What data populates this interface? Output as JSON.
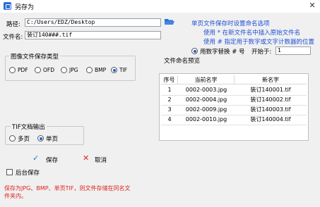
{
  "window": {
    "title": "另存为",
    "close_glyph": "✕"
  },
  "path": {
    "label": "路径:",
    "value": "C:/Users/EDZ/Desktop"
  },
  "filename": {
    "label": "文件名:",
    "value": "装订140###.tif"
  },
  "format_group": {
    "title": "图像文件保存类型",
    "options": [
      "PDF",
      "OFD",
      "JPG",
      "BMP",
      "TIF"
    ],
    "selected": "TIF"
  },
  "tif_group": {
    "title": "TIF文档输出",
    "options": [
      "多页",
      "单页"
    ],
    "selected": "单页"
  },
  "actions": {
    "save": "保存",
    "cancel": "取消",
    "save_icon": "checkmark-icon",
    "cancel_icon": "x-icon",
    "save_color": "#2a6fd6",
    "cancel_color": "#e02020"
  },
  "after_save": {
    "label": "后台保存",
    "checked": false
  },
  "warning": "保存为JPG、BMP、单页TIF，则文件存储在同名文件夹内。",
  "tips": {
    "line1": "单页文件保存时设置命名选项",
    "line2": "使用 * 在新文件名中插入原始文件名",
    "line3": "使用 # 指定用于数字或文字计数器的位置"
  },
  "counter": {
    "label": "用数字替换 # 号",
    "checked": true,
    "start_label": "开始于:",
    "start_value": "1"
  },
  "preview": {
    "title": "文件命名预览",
    "headers": [
      "序号",
      "当前名字",
      "新名字"
    ],
    "rows": [
      [
        "1",
        "0002-0003.jpg",
        "装订140001.tif"
      ],
      [
        "2",
        "0002-0004.jpg",
        "装订140002.tif"
      ],
      [
        "3",
        "0002-0009.jpg",
        "装订140003.tif"
      ],
      [
        "4",
        "0002-0010.jpg",
        "装订140004.tif"
      ]
    ]
  }
}
